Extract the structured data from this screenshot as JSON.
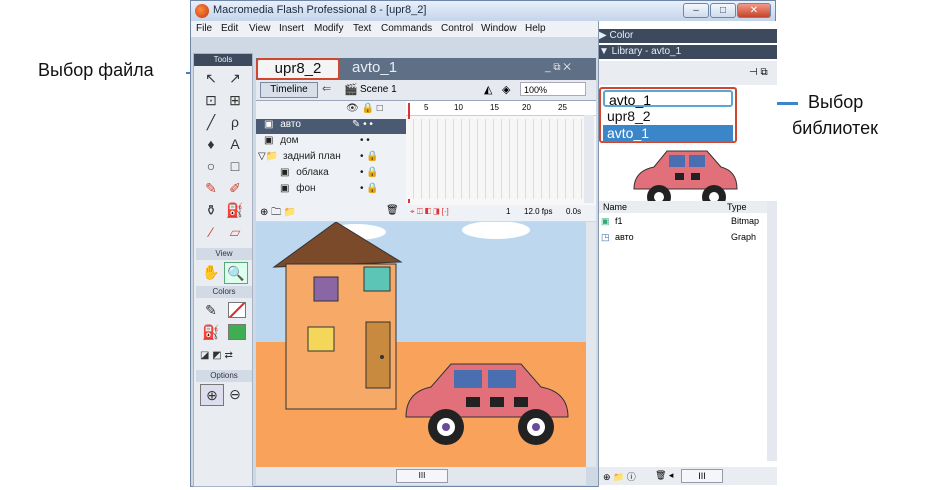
{
  "annotations": {
    "file_select": "Выбор файла",
    "library_select_line1": "Выбор",
    "library_select_line2": "библиотек"
  },
  "window": {
    "title": "Macromedia Flash Professional 8 - [upr8_2]",
    "controls": {
      "minimize": "–",
      "maximize": "□",
      "close": "✕"
    }
  },
  "menu": [
    "File",
    "Edit",
    "View",
    "Insert",
    "Modify",
    "Text",
    "Commands",
    "Control",
    "Window",
    "Help"
  ],
  "tools": {
    "title": "Tools",
    "view_label": "View",
    "colors_label": "Colors",
    "options_label": "Options"
  },
  "document": {
    "tabs": [
      {
        "label": "upr8_2"
      },
      {
        "label": "avto_1"
      }
    ],
    "doc_controls": "_ ⧉ ✕",
    "timeline_button": "Timeline",
    "scene_label": "Scene 1",
    "zoom": "100%",
    "frame_numbers": [
      "5",
      "10",
      "15",
      "20",
      "25"
    ],
    "layers": [
      {
        "name": "авто"
      },
      {
        "name": "дом"
      },
      {
        "name": "задний план"
      },
      {
        "name": "облака"
      },
      {
        "name": "фон"
      }
    ],
    "frame_readout": "1",
    "fps": "12.0 fps",
    "time": "0.0s",
    "hscroll_label": "III"
  },
  "panels": {
    "color_header": "▶ Color",
    "library_header": "▼ Library - avto_1",
    "library_options": [
      "avto_1",
      "upr8_2",
      "avto_1"
    ],
    "list_headers": {
      "name": "Name",
      "type": "Type"
    },
    "items": [
      {
        "name": "f1",
        "type": "Bitmap"
      },
      {
        "name": "авто",
        "type": "Graph"
      }
    ],
    "bottom_scroll": "III"
  }
}
